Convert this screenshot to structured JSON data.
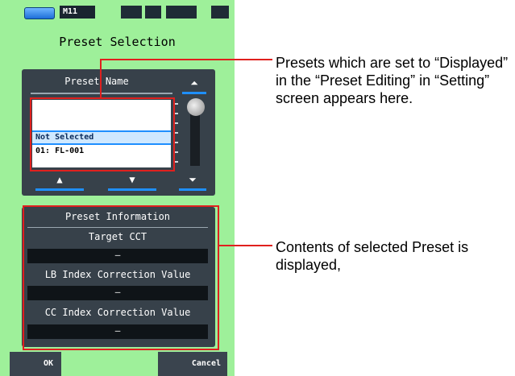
{
  "status_bar": {
    "mode_label": "M11"
  },
  "screen": {
    "title": "Preset Selection"
  },
  "preset_list": {
    "header": "Preset Name",
    "items": [
      "Not Selected",
      "01: FL-001"
    ],
    "nav": {
      "top": "⏶",
      "up": "▲",
      "down": "▼",
      "bottom": "⏷"
    }
  },
  "preset_info": {
    "header": "Preset Information",
    "fields": [
      {
        "label": "Target CCT",
        "value": "—"
      },
      {
        "label": "LB Index Correction Value",
        "value": "—"
      },
      {
        "label": "CC Index Correction Value",
        "value": "—"
      }
    ]
  },
  "bottom_bar": {
    "ok_label": "OK",
    "cancel_label": "Cancel"
  },
  "annotations": {
    "list_note": "Presets which are set to “Displayed” in the “Preset Editing” in “Setting” screen appears here.",
    "info_note": "Contents of selected Preset is displayed,"
  },
  "colors": {
    "screen_bg": "#9ef09a",
    "panel": "#37414a",
    "highlight": "#e0201e",
    "accent": "#1f8fff"
  }
}
